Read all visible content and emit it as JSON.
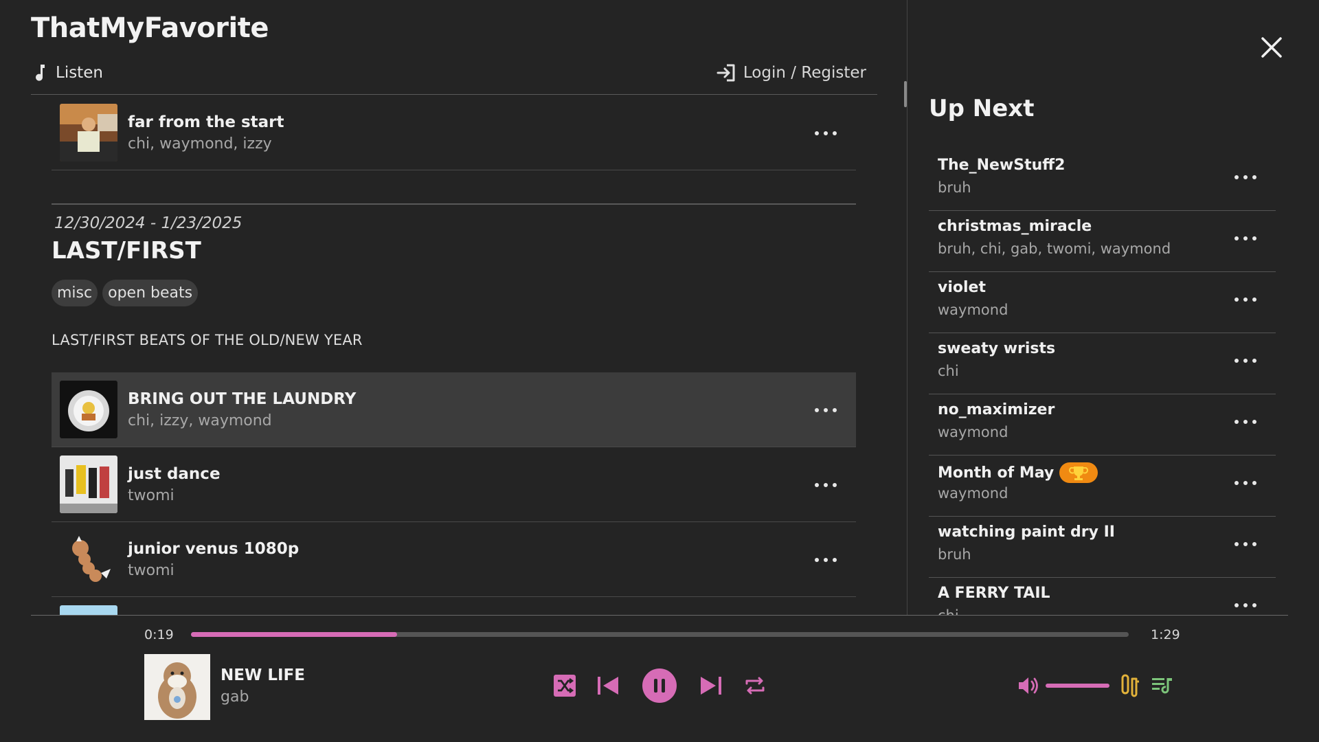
{
  "app": {
    "title": "ThatMyFavorite"
  },
  "nav": {
    "listen_label": "Listen",
    "login_label": "Login / Register"
  },
  "prev_album_tracks": [
    {
      "title": "far from the start",
      "artists": "chi, waymond, izzy"
    }
  ],
  "album": {
    "dates": "12/30/2024 - 1/23/2025",
    "title": "LAST/FIRST",
    "tags": [
      "misc",
      "open beats"
    ],
    "description": "LAST/FIRST BEATS OF THE OLD/NEW YEAR",
    "tracks": [
      {
        "title": "BRING OUT THE LAUNDRY",
        "artists": "chi, izzy, waymond",
        "active": true
      },
      {
        "title": "just dance",
        "artists": "twomi",
        "active": false
      },
      {
        "title": "junior venus 1080p",
        "artists": "twomi",
        "active": false
      }
    ]
  },
  "up_next": {
    "title": "Up Next",
    "items": [
      {
        "title": "The_NewStuff2",
        "artists": "bruh"
      },
      {
        "title": "christmas_miracle",
        "artists": "bruh, chi, gab, twomi, waymond"
      },
      {
        "title": "violet",
        "artists": "waymond"
      },
      {
        "title": "sweaty wrists",
        "artists": "chi"
      },
      {
        "title": "no_maximizer",
        "artists": "waymond"
      },
      {
        "title": "Month of May",
        "artists": "waymond",
        "badge": "trophy-icon"
      },
      {
        "title": "watching paint dry II",
        "artists": "bruh"
      },
      {
        "title": "A FERRY TAIL",
        "artists": "chi"
      }
    ]
  },
  "player": {
    "current_time": "0:19",
    "total_time": "1:29",
    "progress_fraction": 0.22,
    "volume_fraction": 1.0,
    "now_playing": {
      "title": "NEW LIFE",
      "artist": "gab"
    },
    "icons": [
      "shuffle-icon",
      "previous-icon",
      "pause-icon",
      "next-icon",
      "repeat-icon",
      "volume-icon",
      "mic-icon",
      "queue-icon"
    ]
  },
  "colors": {
    "accent": "#d66cb6",
    "background": "#242424",
    "active_row": "#3c3c3c",
    "trophy_badge": "#f08a12",
    "mic_icon": "#e2b23a",
    "queue_icon": "#7cc47a"
  }
}
